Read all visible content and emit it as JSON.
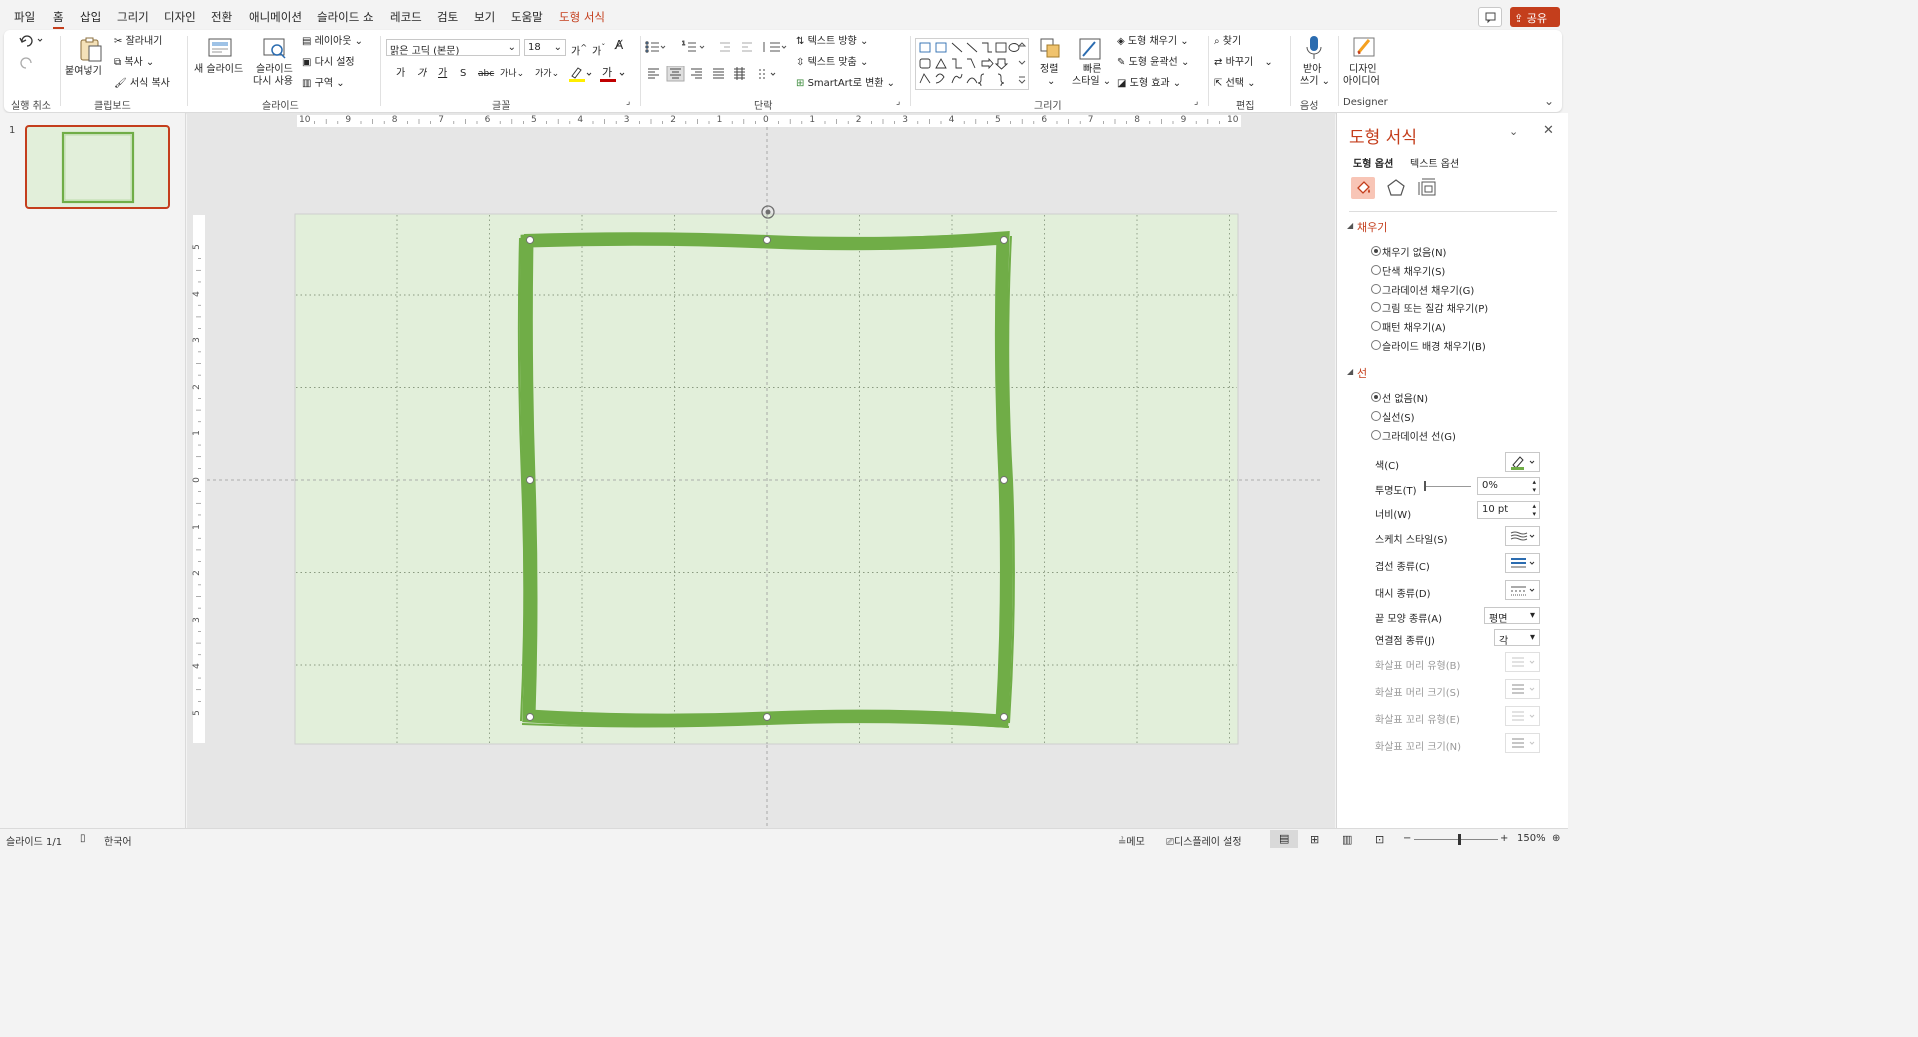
{
  "menu": {
    "items": [
      "파일",
      "홈",
      "삽입",
      "그리기",
      "디자인",
      "전환",
      "애니메이션",
      "슬라이드 쇼",
      "레코드",
      "검토",
      "보기",
      "도움말"
    ],
    "context_tab": "도형 서식",
    "active": "홈",
    "share": "공유"
  },
  "ribbon": {
    "undo_group": "실행 취소",
    "clipboard": {
      "paste": "붙여넣기",
      "cut": "잘라내기",
      "copy": "복사",
      "format_painter": "서식 복사",
      "group": "클립보드"
    },
    "slides": {
      "new_slide": "새 슬라이드",
      "reuse_line1": "슬라이드",
      "reuse_line2": "다시 사용",
      "layout": "레이아웃",
      "reset": "다시 설정",
      "section": "구역",
      "group": "슬라이드"
    },
    "font": {
      "name": "맑은 고딕 (본문)",
      "size": "18",
      "group": "글꼴",
      "bold": "가",
      "italic": "가",
      "underline": "가",
      "shadow": "S",
      "strike": "abc",
      "spacing": "가나",
      "case": "가가"
    },
    "paragraph": {
      "group": "단락",
      "text_direction": "텍스트 방향",
      "align_text": "텍스트 맞춤",
      "smartart": "SmartArt로 변환"
    },
    "drawing": {
      "arrange": "정렬",
      "quick_styles_line1": "빠른",
      "quick_styles_line2": "스타일",
      "shape_fill": "도형 채우기",
      "shape_outline": "도형 윤곽선",
      "shape_effects": "도형 효과",
      "group": "그리기"
    },
    "editing": {
      "find": "찾기",
      "replace": "바꾸기",
      "select": "선택",
      "group": "편집"
    },
    "voice": {
      "dictate_line1": "받아",
      "dictate_line2": "쓰기",
      "group": "음성"
    },
    "designer": {
      "label_line1": "디자인",
      "label_line2": "아이디어",
      "group": "Designer"
    }
  },
  "thumbnails": [
    {
      "number": "1"
    }
  ],
  "ruler": {
    "h_ticks": [
      "10",
      "9",
      "8",
      "7",
      "6",
      "5",
      "4",
      "3",
      "2",
      "1",
      "0",
      "1",
      "2",
      "3",
      "4",
      "5",
      "6",
      "7",
      "8",
      "9",
      "10"
    ],
    "v_ticks": [
      "5",
      "4",
      "3",
      "2",
      "1",
      "0",
      "1",
      "2",
      "3",
      "4",
      "5"
    ]
  },
  "format_pane": {
    "title": "도형 서식",
    "tabs": [
      "도형 옵션",
      "텍스트 옵션"
    ],
    "fill_section": "채우기",
    "fill_options": [
      {
        "label": "채우기 없음(N)",
        "selected": true
      },
      {
        "label": "단색 채우기(S)",
        "selected": false
      },
      {
        "label": "그라데이션 채우기(G)",
        "selected": false
      },
      {
        "label": "그림 또는 질감 채우기(P)",
        "selected": false
      },
      {
        "label": "패턴 채우기(A)",
        "selected": false
      },
      {
        "label": "슬라이드 배경 채우기(B)",
        "selected": false
      }
    ],
    "line_section": "선",
    "line_options": [
      {
        "label": "선 없음(N)",
        "selected": true
      },
      {
        "label": "실선(S)",
        "selected": false
      },
      {
        "label": "그라데이션 선(G)",
        "selected": false
      }
    ],
    "props": {
      "color": "색(C)",
      "transparency": "투명도(T)",
      "transparency_value": "0%",
      "width": "너비(W)",
      "width_value": "10 pt",
      "sketch": "스케치 스타일(S)",
      "compound": "겹선 종류(C)",
      "dash": "대시 종류(D)",
      "cap": "끝 모양 종류(A)",
      "cap_value": "평면",
      "join": "연결점 종류(J)",
      "join_value": "각",
      "begin_type": "화살표 머리 유형(B)",
      "begin_size": "화살표 머리 크기(S)",
      "end_type": "화살표 꼬리 유형(E)",
      "end_size": "화살표 꼬리 크기(N)"
    }
  },
  "status": {
    "slide": "슬라이드 1/1",
    "language": "한국어",
    "notes": "메모",
    "display": "디스플레이 설정",
    "zoom": "150%",
    "zoom_level": 0.54
  },
  "colors": {
    "accent": "#c43e1c",
    "slide_bg": "#e2efda",
    "frame": "#70ad47"
  }
}
